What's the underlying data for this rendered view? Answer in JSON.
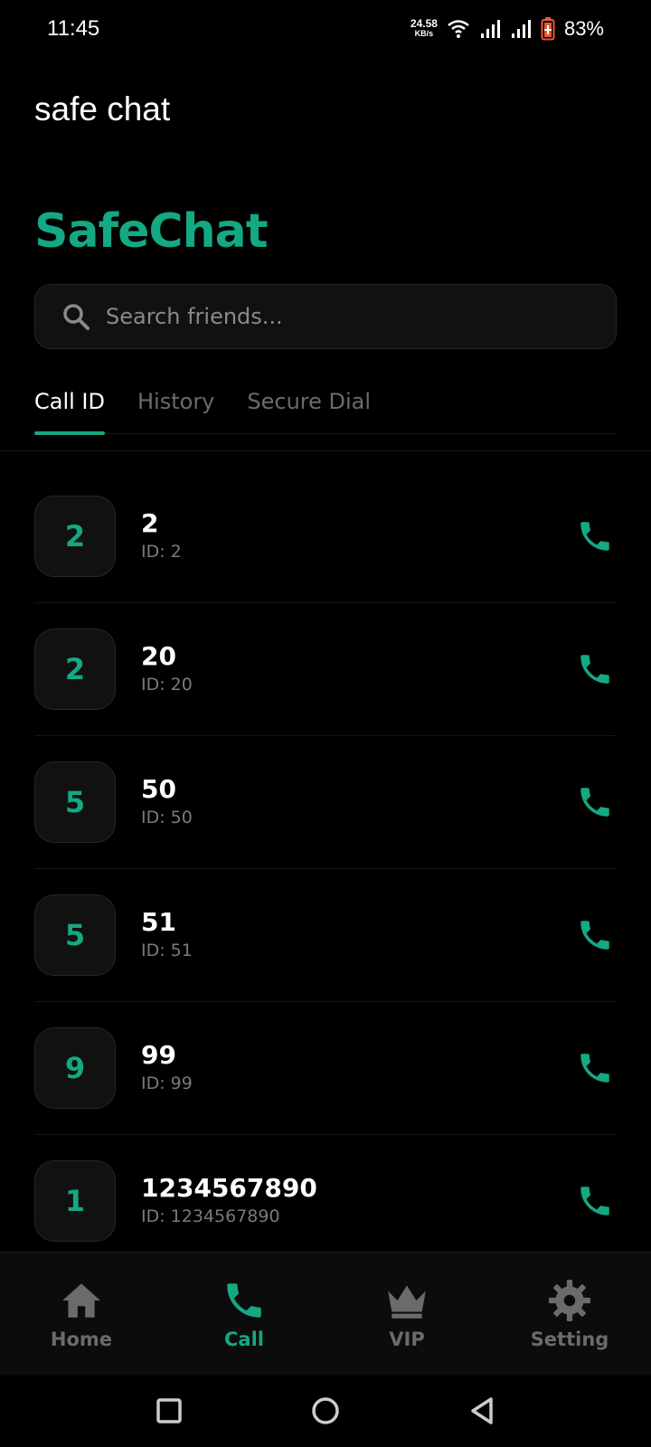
{
  "colors": {
    "accent": "#14a883",
    "muted": "#6b6b6b"
  },
  "status_bar": {
    "time": "11:45",
    "net_speed_value": "24.58",
    "net_speed_unit": "KB/s",
    "battery": "83%"
  },
  "app_bar": {
    "title": "safe chat"
  },
  "brand": {
    "title": "SafeChat"
  },
  "search": {
    "placeholder": "Search friends..."
  },
  "tabs": [
    {
      "label": "Call ID",
      "active": true
    },
    {
      "label": "History",
      "active": false
    },
    {
      "label": "Secure Dial",
      "active": false
    }
  ],
  "contacts": [
    {
      "initial": "2",
      "name": "2",
      "id": "ID: 2"
    },
    {
      "initial": "2",
      "name": "20",
      "id": "ID: 20"
    },
    {
      "initial": "5",
      "name": "50",
      "id": "ID: 50"
    },
    {
      "initial": "5",
      "name": "51",
      "id": "ID: 51"
    },
    {
      "initial": "9",
      "name": "99",
      "id": "ID: 99"
    },
    {
      "initial": "1",
      "name": "1234567890",
      "id": "ID: 1234567890"
    }
  ],
  "bottom_nav": [
    {
      "label": "Home",
      "icon": "home-icon",
      "active": false
    },
    {
      "label": "Call",
      "icon": "phone-icon",
      "active": true
    },
    {
      "label": "VIP",
      "icon": "crown-icon",
      "active": false
    },
    {
      "label": "Setting",
      "icon": "gear-icon",
      "active": false
    }
  ]
}
